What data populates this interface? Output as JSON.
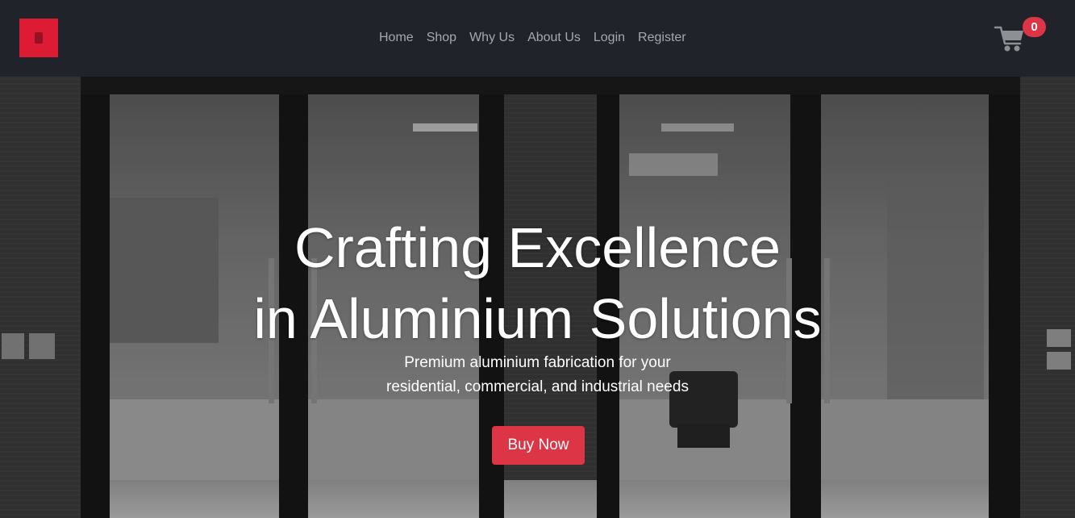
{
  "header": {
    "nav": [
      {
        "label": "Home"
      },
      {
        "label": "Shop"
      },
      {
        "label": "Why Us"
      },
      {
        "label": "About Us"
      },
      {
        "label": "Login"
      },
      {
        "label": "Register"
      }
    ],
    "cart": {
      "icon": "shopping-cart-icon",
      "count": "0"
    },
    "logo_color": "#dc1c34"
  },
  "hero": {
    "title_line1": "Crafting Excellence",
    "title_line2": "in Aluminium Solutions",
    "subtitle_line1": "Premium aluminium fabrication for your",
    "subtitle_line2": "residential, commercial, and industrial needs",
    "cta_label": "Buy Now",
    "cta_color": "#dc3545"
  }
}
